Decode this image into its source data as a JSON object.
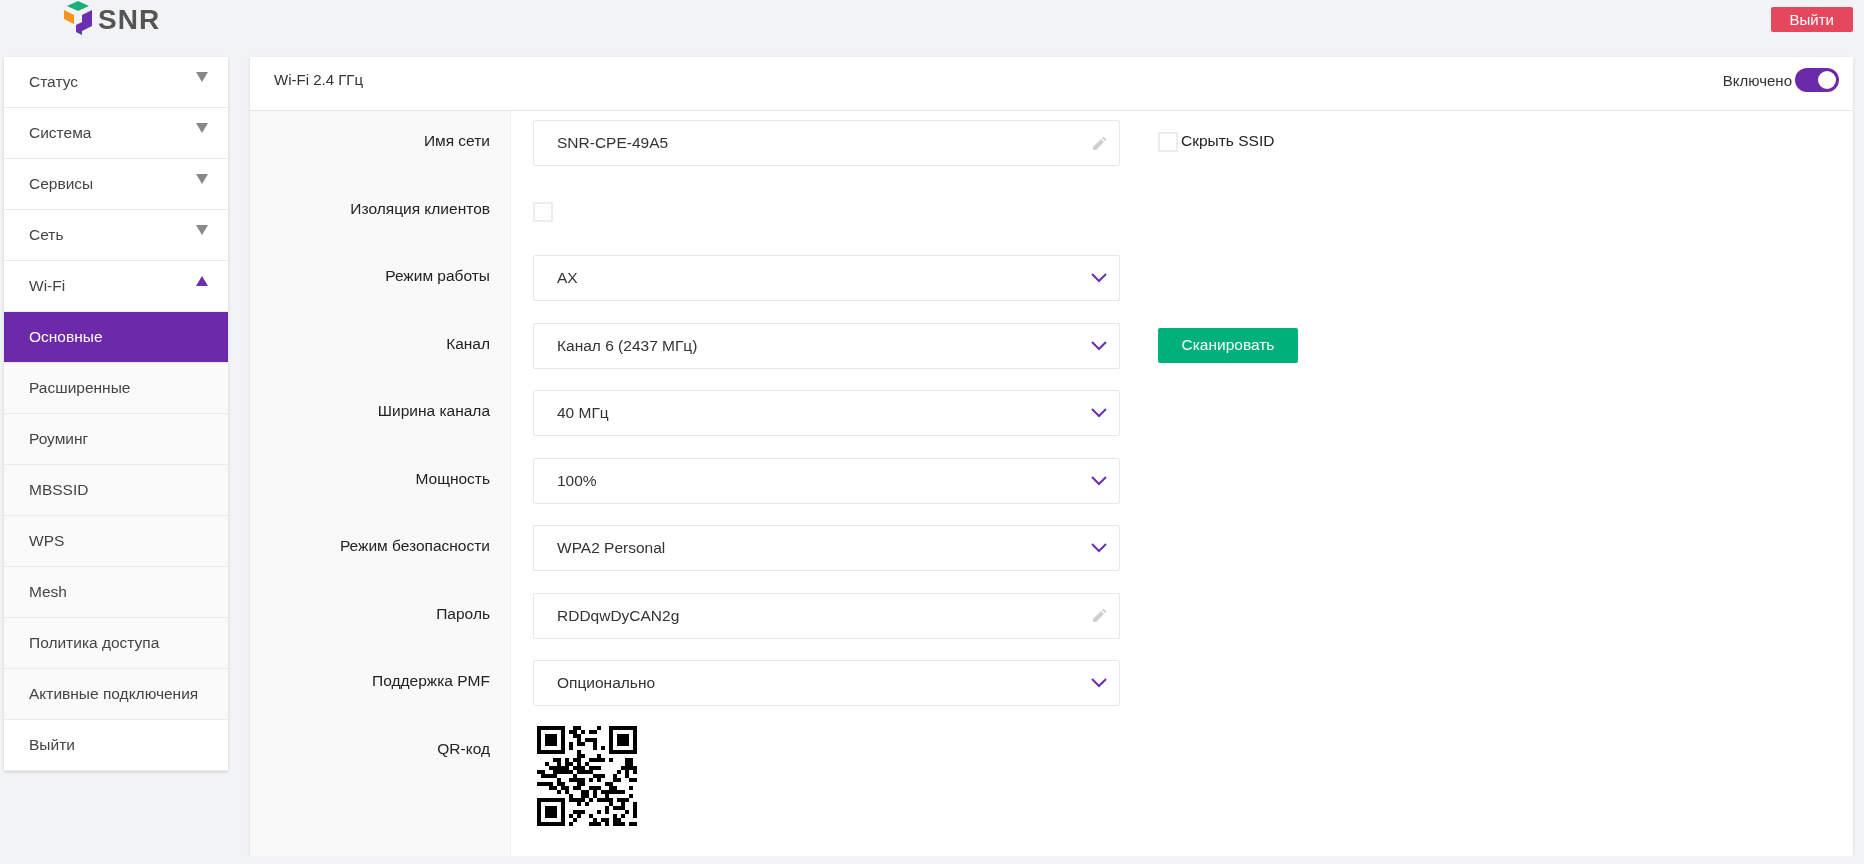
{
  "header": {
    "logo_text": "SNR",
    "logout_button": "Выйти"
  },
  "sidebar": {
    "items": [
      {
        "kind": "group",
        "label": "Статус",
        "expanded": false
      },
      {
        "kind": "group",
        "label": "Система",
        "expanded": false
      },
      {
        "kind": "group",
        "label": "Сервисы",
        "expanded": false
      },
      {
        "kind": "group",
        "label": "Сеть",
        "expanded": false
      },
      {
        "kind": "group",
        "label": "Wi-Fi",
        "expanded": true,
        "children": [
          {
            "label": "Основные",
            "selected": true
          },
          {
            "label": "Расширенные",
            "selected": false
          },
          {
            "label": "Роуминг",
            "selected": false
          },
          {
            "label": "MBSSID",
            "selected": false
          },
          {
            "label": "WPS",
            "selected": false
          },
          {
            "label": "Mesh",
            "selected": false
          },
          {
            "label": "Политика доступа",
            "selected": false
          },
          {
            "label": "Активные подключения",
            "selected": false
          }
        ]
      },
      {
        "kind": "link",
        "label": "Выйти"
      }
    ]
  },
  "panel": {
    "title": "Wi-Fi 2.4 ГГц",
    "toggle": {
      "label": "Включено",
      "on": true
    },
    "rows": [
      {
        "kind": "text",
        "label": "Имя сети",
        "value": "SNR-CPE-49A5",
        "aside": {
          "kind": "checkbox",
          "label": "Скрыть SSID",
          "checked": false
        }
      },
      {
        "kind": "checkbox",
        "label": "Изоляция клиентов",
        "checked": false
      },
      {
        "kind": "select",
        "label": "Режим работы",
        "value": "AX"
      },
      {
        "kind": "select",
        "label": "Канал",
        "value": "Канал 6 (2437 МГц)",
        "aside": {
          "kind": "button",
          "label": "Сканировать"
        }
      },
      {
        "kind": "select",
        "label": "Ширина канала",
        "value": "40 МГц"
      },
      {
        "kind": "select",
        "label": "Мощность",
        "value": "100%"
      },
      {
        "kind": "select",
        "label": "Режим безопасности",
        "value": "WPA2 Personal"
      },
      {
        "kind": "text",
        "label": "Пароль",
        "value": "RDDqwDyCAN2g"
      },
      {
        "kind": "select",
        "label": "Поддержка PMF",
        "value": "Опционально"
      },
      {
        "kind": "qr",
        "label": "QR-код"
      }
    ]
  }
}
